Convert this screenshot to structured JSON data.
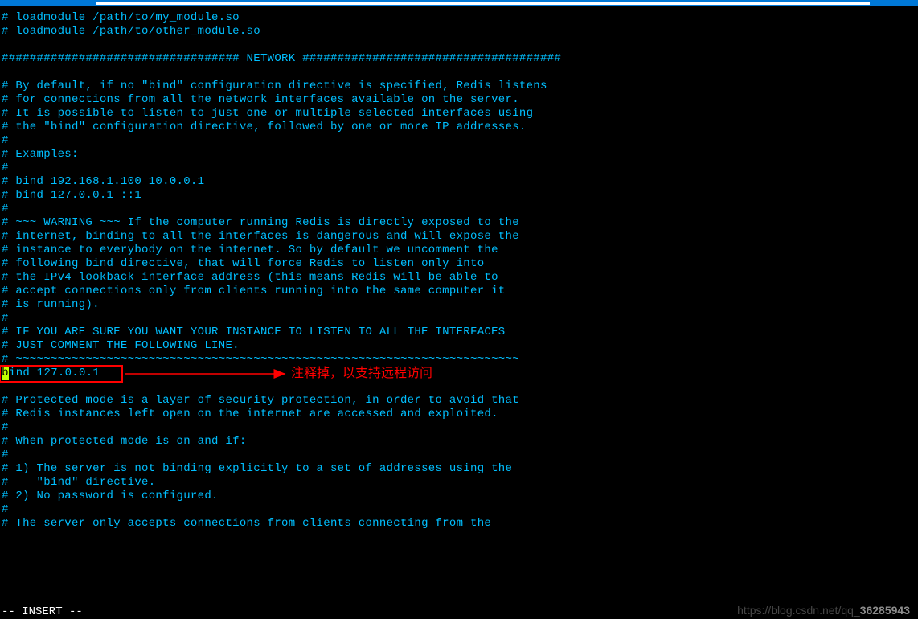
{
  "titlebar": {
    "accent": "#0078d7"
  },
  "lines": [
    "# loadmodule /path/to/my_module.so",
    "# loadmodule /path/to/other_module.so",
    "",
    "################################## NETWORK #####################################",
    "",
    "# By default, if no \"bind\" configuration directive is specified, Redis listens",
    "# for connections from all the network interfaces available on the server.",
    "# It is possible to listen to just one or multiple selected interfaces using",
    "# the \"bind\" configuration directive, followed by one or more IP addresses.",
    "#",
    "# Examples:",
    "#",
    "# bind 192.168.1.100 10.0.0.1",
    "# bind 127.0.0.1 ::1",
    "#",
    "# ~~~ WARNING ~~~ If the computer running Redis is directly exposed to the",
    "# internet, binding to all the interfaces is dangerous and will expose the",
    "# instance to everybody on the internet. So by default we uncomment the",
    "# following bind directive, that will force Redis to listen only into",
    "# the IPv4 lookback interface address (this means Redis will be able to",
    "# accept connections only from clients running into the same computer it",
    "# is running).",
    "#",
    "# IF YOU ARE SURE YOU WANT YOUR INSTANCE TO LISTEN TO ALL THE INTERFACES",
    "# JUST COMMENT THE FOLLOWING LINE.",
    "# ~~~~~~~~~~~~~~~~~~~~~~~~~~~~~~~~~~~~~~~~~~~~~~~~~~~~~~~~~~~~~~~~~~~~~~~~",
    "",
    "# Protected mode is a layer of security protection, in order to avoid that",
    "# Redis instances left open on the internet are accessed and exploited.",
    "#",
    "# When protected mode is on and if:",
    "#",
    "# 1) The server is not binding explicitly to a set of addresses using the",
    "#    \"bind\" directive.",
    "# 2) No password is configured.",
    "#",
    "# The server only accepts connections from clients connecting from the"
  ],
  "bind_line": {
    "cursor_char": "b",
    "rest": "ind 127.0.0.1"
  },
  "status": "-- INSERT --",
  "annotation": "注释掉，以支持远程访问",
  "watermark": {
    "prefix": "https://blog.csdn.net/qq_",
    "num": "36285943"
  }
}
